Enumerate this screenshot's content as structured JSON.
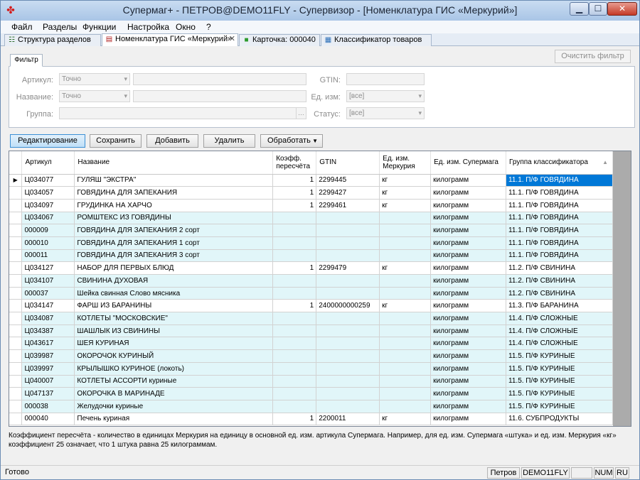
{
  "window": {
    "title": "Супермаг+ - ПЕТРОВ@DEMO11FLY - Супервизор  - [Номенклатура ГИС «Меркурий»]"
  },
  "menu": [
    "Файл",
    "Разделы",
    "Функции",
    "Настройка",
    "Окно",
    "?"
  ],
  "tabs": [
    {
      "label": "Структура разделов",
      "icon": "tree-icon"
    },
    {
      "label": "Номенклатура ГИС «Меркурий»",
      "icon": "document-icon",
      "active": true
    },
    {
      "label": "Карточка: 000040",
      "icon": "card-icon"
    },
    {
      "label": "Классификатор товаров",
      "icon": "classifier-icon"
    }
  ],
  "filter": {
    "tab_label": "Фильтр",
    "clear_label": "Очистить фильтр",
    "article_label": "Артикул:",
    "article_mode": "Точно",
    "name_label": "Название:",
    "name_mode": "Точно",
    "group_label": "Группа:",
    "gtin_label": "GTIN:",
    "unit_label": "Ед. изм:",
    "unit_value": "[все]",
    "status_label": "Статус:",
    "status_value": "[все]"
  },
  "toolbar": {
    "edit": "Редактирование",
    "save": "Сохранить",
    "add": "Добавить",
    "delete": "Удалить",
    "process": "Обработать"
  },
  "grid": {
    "columns": {
      "article": "Артикул",
      "name": "Название",
      "coef": "Коэфф. пересчёта",
      "gtin": "GTIN",
      "unit_merc": "Ед. изм. Меркурия",
      "unit_sm": "Ед. изм. Супермага",
      "group": "Группа классификатора"
    },
    "rows": [
      {
        "article": "Ц034077",
        "name": "ГУЛЯШ \"ЭКСТРА\"",
        "coef": "1",
        "gtin": "2299445",
        "unit_merc": "кг",
        "unit_sm": "килограмм",
        "group": "11.1. П/Ф ГОВЯДИНА"
      },
      {
        "article": "Ц034057",
        "name": "ГОВЯДИНА  ДЛЯ ЗАПЕКАНИЯ",
        "coef": "1",
        "gtin": "2299427",
        "unit_merc": "кг",
        "unit_sm": "килограмм",
        "group": "11.1. П/Ф ГОВЯДИНА"
      },
      {
        "article": "Ц034097",
        "name": "ГРУДИНКА  НА ХАРЧО",
        "coef": "1",
        "gtin": "2299461",
        "unit_merc": "кг",
        "unit_sm": "килограмм",
        "group": "11.1. П/Ф ГОВЯДИНА"
      },
      {
        "article": "Ц034067",
        "name": "РОМШТЕКС ИЗ ГОВЯДИНЫ",
        "coef": "",
        "gtin": "",
        "unit_merc": "",
        "unit_sm": "килограмм",
        "group": "11.1. П/Ф ГОВЯДИНА"
      },
      {
        "article": "000009",
        "name": "ГОВЯДИНА  ДЛЯ ЗАПЕКАНИЯ 2 сорт",
        "coef": "",
        "gtin": "",
        "unit_merc": "",
        "unit_sm": "килограмм",
        "group": "11.1. П/Ф ГОВЯДИНА"
      },
      {
        "article": "000010",
        "name": "ГОВЯДИНА  ДЛЯ ЗАПЕКАНИЯ 1 сорт",
        "coef": "",
        "gtin": "",
        "unit_merc": "",
        "unit_sm": "килограмм",
        "group": "11.1. П/Ф ГОВЯДИНА"
      },
      {
        "article": "000011",
        "name": "ГОВЯДИНА  ДЛЯ ЗАПЕКАНИЯ 3 сорт",
        "coef": "",
        "gtin": "",
        "unit_merc": "",
        "unit_sm": "килограмм",
        "group": "11.1. П/Ф ГОВЯДИНА"
      },
      {
        "article": "Ц034127",
        "name": "НАБОР ДЛЯ ПЕРВЫХ БЛЮД",
        "coef": "1",
        "gtin": "2299479",
        "unit_merc": "кг",
        "unit_sm": "килограмм",
        "group": "11.2. П/Ф СВИНИНА"
      },
      {
        "article": "Ц034107",
        "name": "СВИНИНА ДУХОВАЯ",
        "coef": "",
        "gtin": "",
        "unit_merc": "",
        "unit_sm": "килограмм",
        "group": "11.2. П/Ф СВИНИНА"
      },
      {
        "article": "000037",
        "name": "Шейка свинная Слово мясника",
        "coef": "",
        "gtin": "",
        "unit_merc": "",
        "unit_sm": "килограмм",
        "group": "11.2. П/Ф СВИНИНА"
      },
      {
        "article": "Ц034147",
        "name": "ФАРШ ИЗ БАРАНИНЫ",
        "coef": "1",
        "gtin": "2400000000259",
        "unit_merc": "кг",
        "unit_sm": "килограмм",
        "group": "11.3. П/Ф БАРАНИНА"
      },
      {
        "article": "Ц034087",
        "name": "КОТЛЕТЫ \"МОСКОВСКИЕ\"",
        "coef": "",
        "gtin": "",
        "unit_merc": "",
        "unit_sm": "килограмм",
        "group": "11.4. П/Ф СЛОЖНЫЕ"
      },
      {
        "article": "Ц034387",
        "name": "ШАШЛЫК ИЗ СВИНИНЫ",
        "coef": "",
        "gtin": "",
        "unit_merc": "",
        "unit_sm": "килограмм",
        "group": "11.4. П/Ф СЛОЖНЫЕ"
      },
      {
        "article": "Ц043617",
        "name": "ШЕЯ КУРИНАЯ",
        "coef": "",
        "gtin": "",
        "unit_merc": "",
        "unit_sm": "килограмм",
        "group": "11.4. П/Ф СЛОЖНЫЕ"
      },
      {
        "article": "Ц039987",
        "name": "ОКОРОЧОК КУРИНЫЙ",
        "coef": "",
        "gtin": "",
        "unit_merc": "",
        "unit_sm": "килограмм",
        "group": "11.5. П/Ф КУРИНЫЕ"
      },
      {
        "article": "Ц039997",
        "name": "КРЫЛЫШКО КУРИНОЕ (локоть)",
        "coef": "",
        "gtin": "",
        "unit_merc": "",
        "unit_sm": "килограмм",
        "group": "11.5. П/Ф КУРИНЫЕ"
      },
      {
        "article": "Ц040007",
        "name": "КОТЛЕТЫ АССОРТИ куриные",
        "coef": "",
        "gtin": "",
        "unit_merc": "",
        "unit_sm": "килограмм",
        "group": "11.5. П/Ф КУРИНЫЕ"
      },
      {
        "article": "Ц047137",
        "name": "ОКОРОЧКА В МАРИНАДЕ",
        "coef": "",
        "gtin": "",
        "unit_merc": "",
        "unit_sm": "килограмм",
        "group": "11.5. П/Ф КУРИНЫЕ"
      },
      {
        "article": "000038",
        "name": "Желудочки куриные",
        "coef": "",
        "gtin": "",
        "unit_merc": "",
        "unit_sm": "килограмм",
        "group": "11.5. П/Ф КУРИНЫЕ"
      },
      {
        "article": "000040",
        "name": "Печень куриная",
        "coef": "1",
        "gtin": "2200011",
        "unit_merc": "кг",
        "unit_sm": "килограмм",
        "group": "11.6. СУБПРОДУКТЫ"
      }
    ]
  },
  "note": "Коэффициент пересчёта  - количество в единицах Меркурия на единицу в основной ед. изм. артикула Супермага. Например, для ед. изм. Супермага «штука» и ед. изм. Меркурия «кг» коэффициент 25 означает, что 1 штука равна 25 килограммам.",
  "status": {
    "text": "Готово",
    "user": "Петров",
    "db": "DEMO11FLY",
    "num": "NUM",
    "lang": "RU"
  },
  "colors": {
    "selected": "#0078d7",
    "row_tint": "#e1f6f9",
    "accent_button": "#bfdff7"
  }
}
